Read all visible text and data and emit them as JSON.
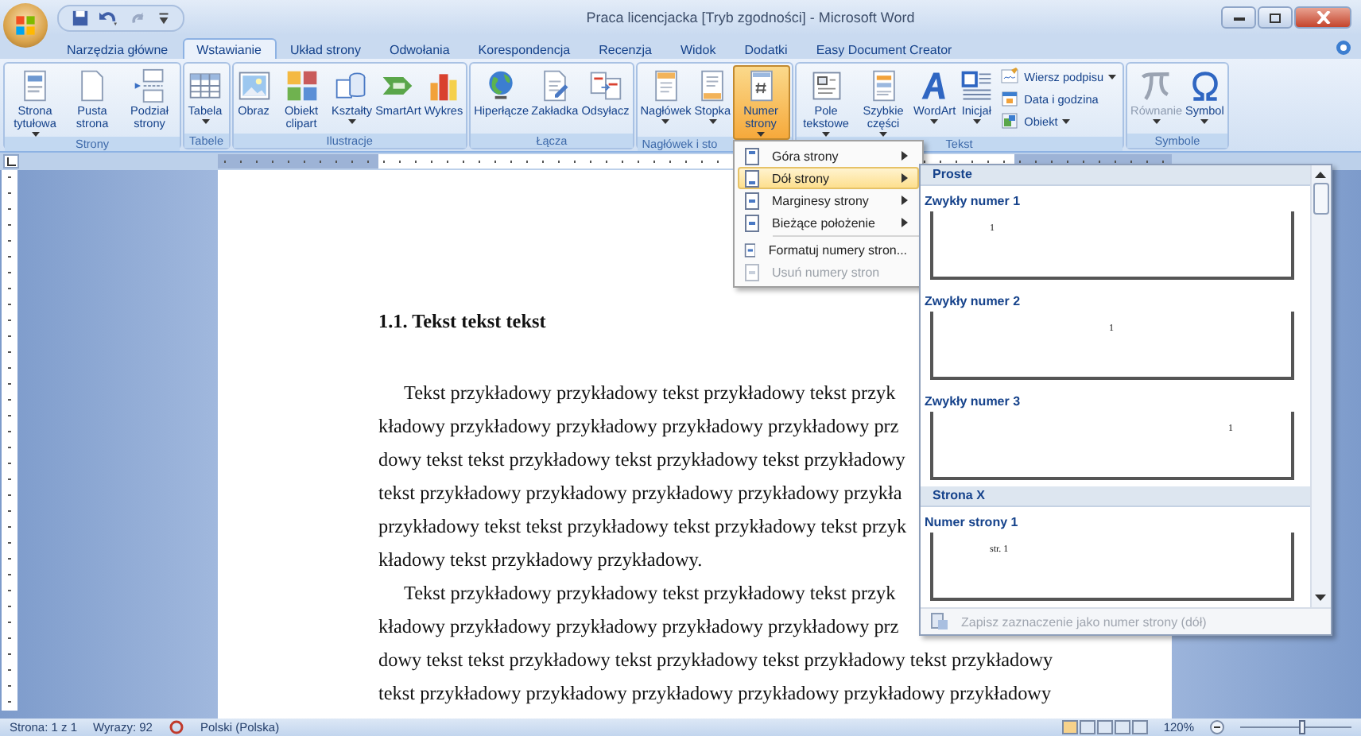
{
  "window": {
    "title": "Praca licencjacka [Tryb zgodności] - Microsoft Word"
  },
  "tabs": [
    {
      "label": "Narzędzia główne",
      "selected": false
    },
    {
      "label": "Wstawianie",
      "selected": true
    },
    {
      "label": "Układ strony",
      "selected": false
    },
    {
      "label": "Odwołania",
      "selected": false
    },
    {
      "label": "Korespondencja",
      "selected": false
    },
    {
      "label": "Recenzja",
      "selected": false
    },
    {
      "label": "Widok",
      "selected": false
    },
    {
      "label": "Dodatki",
      "selected": false
    },
    {
      "label": "Easy Document Creator",
      "selected": false
    }
  ],
  "ribbon": {
    "groups": [
      {
        "label": "Strony",
        "buttons": [
          {
            "kind": "large",
            "label": "Strona tytułowa",
            "dropdown": true,
            "selected": false,
            "disabled": false
          },
          {
            "kind": "large",
            "label": "Pusta strona",
            "dropdown": false,
            "selected": false,
            "disabled": false
          },
          {
            "kind": "large",
            "label": "Podział strony",
            "dropdown": false,
            "selected": false,
            "disabled": false
          }
        ]
      },
      {
        "label": "Tabele",
        "buttons": [
          {
            "kind": "large",
            "label": "Tabela",
            "dropdown": true,
            "selected": false,
            "disabled": false
          }
        ]
      },
      {
        "label": "Ilustracje",
        "buttons": [
          {
            "kind": "large",
            "label": "Obraz",
            "dropdown": false,
            "selected": false,
            "disabled": false
          },
          {
            "kind": "large",
            "label": "Obiekt clipart",
            "dropdown": false,
            "selected": false,
            "disabled": false
          },
          {
            "kind": "large",
            "label": "Kształty",
            "dropdown": true,
            "selected": false,
            "disabled": false
          },
          {
            "kind": "large",
            "label": "SmartArt",
            "dropdown": false,
            "selected": false,
            "disabled": false
          },
          {
            "kind": "large",
            "label": "Wykres",
            "dropdown": false,
            "selected": false,
            "disabled": false
          }
        ]
      },
      {
        "label": "Łącza",
        "buttons": [
          {
            "kind": "large",
            "label": "Hiperłącze",
            "dropdown": false,
            "selected": false,
            "disabled": false
          },
          {
            "kind": "large",
            "label": "Zakładka",
            "dropdown": false,
            "selected": false,
            "disabled": false
          },
          {
            "kind": "large",
            "label": "Odsyłacz",
            "dropdown": false,
            "selected": false,
            "disabled": false
          }
        ]
      },
      {
        "label": "Nagłówek i sto",
        "buttons": [
          {
            "kind": "large",
            "label": "Nagłówek",
            "dropdown": true,
            "selected": false,
            "disabled": false
          },
          {
            "kind": "large",
            "label": "Stopka",
            "dropdown": true,
            "selected": false,
            "disabled": false
          },
          {
            "kind": "large",
            "label": "Numer strony",
            "dropdown": true,
            "selected": true,
            "disabled": false
          }
        ]
      },
      {
        "label": "Tekst",
        "buttons": [
          {
            "kind": "large",
            "label": "Pole tekstowe",
            "dropdown": true,
            "selected": false,
            "disabled": false
          },
          {
            "kind": "large",
            "label": "Szybkie części",
            "dropdown": true,
            "selected": false,
            "disabled": false
          },
          {
            "kind": "large",
            "label": "WordArt",
            "dropdown": true,
            "selected": false,
            "disabled": false
          },
          {
            "kind": "large",
            "label": "Inicjał",
            "dropdown": true,
            "selected": false,
            "disabled": false
          },
          {
            "kind": "small",
            "label": "Wiersz podpisu",
            "dropdown": true,
            "selected": false,
            "disabled": false
          },
          {
            "kind": "small",
            "label": "Data i godzina",
            "dropdown": false,
            "selected": false,
            "disabled": false
          },
          {
            "kind": "small",
            "label": "Obiekt",
            "dropdown": true,
            "selected": false,
            "disabled": false
          }
        ]
      },
      {
        "label": "Symbole",
        "buttons": [
          {
            "kind": "large",
            "label": "Równanie",
            "dropdown": true,
            "selected": false,
            "disabled": true
          },
          {
            "kind": "large",
            "label": "Symbol",
            "dropdown": true,
            "selected": false,
            "disabled": false
          }
        ]
      }
    ]
  },
  "page_number_menu": {
    "items": [
      {
        "label": "Góra strony",
        "submenu": true,
        "selected": false,
        "disabled": false,
        "separator_before": false
      },
      {
        "label": "Dół strony",
        "submenu": true,
        "selected": true,
        "disabled": false,
        "separator_before": false
      },
      {
        "label": "Marginesy strony",
        "submenu": true,
        "selected": false,
        "disabled": false,
        "separator_before": false
      },
      {
        "label": "Bieżące położenie",
        "submenu": true,
        "selected": false,
        "disabled": false,
        "separator_before": false
      },
      {
        "label": "Formatuj numery stron...",
        "submenu": false,
        "selected": false,
        "disabled": false,
        "separator_before": true
      },
      {
        "label": "Usuń numery stron",
        "submenu": false,
        "selected": false,
        "disabled": true,
        "separator_before": false
      }
    ]
  },
  "gallery": {
    "entries": [
      {
        "kind": "section",
        "label": "Proste"
      },
      {
        "kind": "item",
        "label": "Zwykły numer 1",
        "preview": "1"
      },
      {
        "kind": "item",
        "label": "Zwykły numer 2",
        "preview": "1"
      },
      {
        "kind": "item",
        "label": "Zwykły numer 3",
        "preview": "1"
      },
      {
        "kind": "section",
        "label": "Strona X"
      },
      {
        "kind": "item",
        "label": "Numer strony 1",
        "preview": "str. 1"
      }
    ],
    "footer": {
      "label": "Zapisz zaznaczenie jako numer strony (dół)",
      "disabled": true
    }
  },
  "document": {
    "heading": "1.1. Tekst tekst tekst",
    "paragraphs": [
      {
        "lines": [
          "Tekst przykładowy przykładowy tekst przykładowy tekst przyk",
          "kładowy przykładowy przykładowy przykładowy przykładowy prz",
          "dowy tekst tekst przykładowy tekst przykładowy tekst przykładowy",
          "tekst przykładowy przykładowy przykładowy przykładowy przykła",
          "przykładowy tekst tekst przykładowy tekst przykładowy tekst przyk",
          "kładowy tekst przykładowy przykładowy."
        ]
      },
      {
        "lines": [
          "Tekst przykładowy przykładowy tekst przykładowy tekst przyk",
          "kładowy przykładowy przykładowy przykładowy przykładowy prz",
          "dowy tekst tekst przykładowy tekst przykładowy tekst przykładowy tekst przykładowy",
          "tekst przykładowy przykładowy przykładowy przykładowy przykładowy przykładowy"
        ]
      }
    ]
  },
  "status_bar": {
    "page": "Strona: 1 z 1",
    "words": "Wyrazy: 92",
    "language": "Polski (Polska)",
    "zoom": "120%",
    "zoom_slider": {
      "level": 0.55
    }
  }
}
